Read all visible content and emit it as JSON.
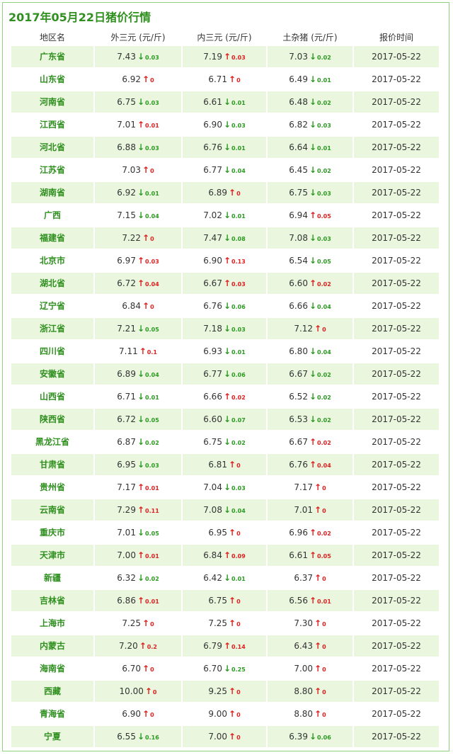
{
  "title": "2017年05月22日猪价行情",
  "headers": [
    "地区名",
    "外三元 (元/斤)",
    "内三元 (元/斤)",
    "土杂猪 (元/斤)",
    "报价时间"
  ],
  "colors": {
    "up": "#e02020",
    "down": "#2a9a20",
    "region": "#2f8f1f",
    "stripe": "#eaf7de"
  },
  "rows": [
    {
      "region": "广东省",
      "w": {
        "p": "7.43",
        "d": "down",
        "c": "0.03"
      },
      "n": {
        "p": "7.19",
        "d": "up",
        "c": "0.03"
      },
      "t": {
        "p": "7.03",
        "d": "down",
        "c": "0.02"
      },
      "date": "2017-05-22"
    },
    {
      "region": "山东省",
      "w": {
        "p": "6.92",
        "d": "up",
        "c": "0"
      },
      "n": {
        "p": "6.71",
        "d": "up",
        "c": "0"
      },
      "t": {
        "p": "6.49",
        "d": "down",
        "c": "0.01"
      },
      "date": "2017-05-22"
    },
    {
      "region": "河南省",
      "w": {
        "p": "6.75",
        "d": "down",
        "c": "0.03"
      },
      "n": {
        "p": "6.61",
        "d": "down",
        "c": "0.01"
      },
      "t": {
        "p": "6.48",
        "d": "down",
        "c": "0.02"
      },
      "date": "2017-05-22"
    },
    {
      "region": "江西省",
      "w": {
        "p": "7.01",
        "d": "up",
        "c": "0.01"
      },
      "n": {
        "p": "6.90",
        "d": "down",
        "c": "0.03"
      },
      "t": {
        "p": "6.82",
        "d": "down",
        "c": "0.03"
      },
      "date": "2017-05-22"
    },
    {
      "region": "河北省",
      "w": {
        "p": "6.88",
        "d": "down",
        "c": "0.03"
      },
      "n": {
        "p": "6.76",
        "d": "down",
        "c": "0.01"
      },
      "t": {
        "p": "6.64",
        "d": "down",
        "c": "0.01"
      },
      "date": "2017-05-22"
    },
    {
      "region": "江苏省",
      "w": {
        "p": "7.03",
        "d": "up",
        "c": "0"
      },
      "n": {
        "p": "6.77",
        "d": "down",
        "c": "0.04"
      },
      "t": {
        "p": "6.45",
        "d": "down",
        "c": "0.02"
      },
      "date": "2017-05-22"
    },
    {
      "region": "湖南省",
      "w": {
        "p": "6.92",
        "d": "down",
        "c": "0.01"
      },
      "n": {
        "p": "6.89",
        "d": "up",
        "c": "0"
      },
      "t": {
        "p": "6.75",
        "d": "down",
        "c": "0.03"
      },
      "date": "2017-05-22"
    },
    {
      "region": "广西",
      "w": {
        "p": "7.15",
        "d": "down",
        "c": "0.04"
      },
      "n": {
        "p": "7.02",
        "d": "down",
        "c": "0.01"
      },
      "t": {
        "p": "6.94",
        "d": "up",
        "c": "0.05"
      },
      "date": "2017-05-22"
    },
    {
      "region": "福建省",
      "w": {
        "p": "7.22",
        "d": "up",
        "c": "0"
      },
      "n": {
        "p": "7.47",
        "d": "down",
        "c": "0.08"
      },
      "t": {
        "p": "7.08",
        "d": "down",
        "c": "0.03"
      },
      "date": "2017-05-22"
    },
    {
      "region": "北京市",
      "w": {
        "p": "6.97",
        "d": "up",
        "c": "0.03"
      },
      "n": {
        "p": "6.90",
        "d": "up",
        "c": "0.13"
      },
      "t": {
        "p": "6.54",
        "d": "down",
        "c": "0.05"
      },
      "date": "2017-05-22"
    },
    {
      "region": "湖北省",
      "w": {
        "p": "6.72",
        "d": "up",
        "c": "0.04"
      },
      "n": {
        "p": "6.67",
        "d": "up",
        "c": "0.03"
      },
      "t": {
        "p": "6.60",
        "d": "up",
        "c": "0.02"
      },
      "date": "2017-05-22"
    },
    {
      "region": "辽宁省",
      "w": {
        "p": "6.84",
        "d": "up",
        "c": "0"
      },
      "n": {
        "p": "6.76",
        "d": "down",
        "c": "0.06"
      },
      "t": {
        "p": "6.66",
        "d": "down",
        "c": "0.04"
      },
      "date": "2017-05-22"
    },
    {
      "region": "浙江省",
      "w": {
        "p": "7.21",
        "d": "down",
        "c": "0.05"
      },
      "n": {
        "p": "7.18",
        "d": "down",
        "c": "0.03"
      },
      "t": {
        "p": "7.12",
        "d": "up",
        "c": "0"
      },
      "date": "2017-05-22"
    },
    {
      "region": "四川省",
      "w": {
        "p": "7.11",
        "d": "up",
        "c": "0.1"
      },
      "n": {
        "p": "6.93",
        "d": "down",
        "c": "0.01"
      },
      "t": {
        "p": "6.80",
        "d": "down",
        "c": "0.04"
      },
      "date": "2017-05-22"
    },
    {
      "region": "安徽省",
      "w": {
        "p": "6.89",
        "d": "down",
        "c": "0.04"
      },
      "n": {
        "p": "6.77",
        "d": "down",
        "c": "0.06"
      },
      "t": {
        "p": "6.67",
        "d": "down",
        "c": "0.02"
      },
      "date": "2017-05-22"
    },
    {
      "region": "山西省",
      "w": {
        "p": "6.71",
        "d": "down",
        "c": "0.01"
      },
      "n": {
        "p": "6.66",
        "d": "up",
        "c": "0.02"
      },
      "t": {
        "p": "6.52",
        "d": "down",
        "c": "0.02"
      },
      "date": "2017-05-22"
    },
    {
      "region": "陕西省",
      "w": {
        "p": "6.72",
        "d": "down",
        "c": "0.05"
      },
      "n": {
        "p": "6.60",
        "d": "down",
        "c": "0.07"
      },
      "t": {
        "p": "6.53",
        "d": "down",
        "c": "0.02"
      },
      "date": "2017-05-22"
    },
    {
      "region": "黑龙江省",
      "w": {
        "p": "6.87",
        "d": "down",
        "c": "0.02"
      },
      "n": {
        "p": "6.75",
        "d": "down",
        "c": "0.02"
      },
      "t": {
        "p": "6.67",
        "d": "up",
        "c": "0.02"
      },
      "date": "2017-05-22"
    },
    {
      "region": "甘肃省",
      "w": {
        "p": "6.95",
        "d": "down",
        "c": "0.03"
      },
      "n": {
        "p": "6.81",
        "d": "up",
        "c": "0"
      },
      "t": {
        "p": "6.76",
        "d": "up",
        "c": "0.04"
      },
      "date": "2017-05-22"
    },
    {
      "region": "贵州省",
      "w": {
        "p": "7.17",
        "d": "up",
        "c": "0.01"
      },
      "n": {
        "p": "7.04",
        "d": "down",
        "c": "0.03"
      },
      "t": {
        "p": "7.17",
        "d": "up",
        "c": "0"
      },
      "date": "2017-05-22"
    },
    {
      "region": "云南省",
      "w": {
        "p": "7.29",
        "d": "up",
        "c": "0.11"
      },
      "n": {
        "p": "7.08",
        "d": "down",
        "c": "0.04"
      },
      "t": {
        "p": "7.01",
        "d": "up",
        "c": "0"
      },
      "date": "2017-05-22"
    },
    {
      "region": "重庆市",
      "w": {
        "p": "7.01",
        "d": "down",
        "c": "0.05"
      },
      "n": {
        "p": "6.95",
        "d": "up",
        "c": "0"
      },
      "t": {
        "p": "6.96",
        "d": "up",
        "c": "0.02"
      },
      "date": "2017-05-22"
    },
    {
      "region": "天津市",
      "w": {
        "p": "7.00",
        "d": "up",
        "c": "0.01"
      },
      "n": {
        "p": "6.84",
        "d": "up",
        "c": "0.09"
      },
      "t": {
        "p": "6.61",
        "d": "up",
        "c": "0.05"
      },
      "date": "2017-05-22"
    },
    {
      "region": "新疆",
      "w": {
        "p": "6.32",
        "d": "down",
        "c": "0.02"
      },
      "n": {
        "p": "6.42",
        "d": "down",
        "c": "0.01"
      },
      "t": {
        "p": "6.37",
        "d": "up",
        "c": "0"
      },
      "date": "2017-05-22"
    },
    {
      "region": "吉林省",
      "w": {
        "p": "6.86",
        "d": "up",
        "c": "0.01"
      },
      "n": {
        "p": "6.75",
        "d": "up",
        "c": "0"
      },
      "t": {
        "p": "6.56",
        "d": "up",
        "c": "0.01"
      },
      "date": "2017-05-22"
    },
    {
      "region": "上海市",
      "w": {
        "p": "7.25",
        "d": "up",
        "c": "0"
      },
      "n": {
        "p": "7.25",
        "d": "up",
        "c": "0"
      },
      "t": {
        "p": "7.30",
        "d": "up",
        "c": "0"
      },
      "date": "2017-05-22"
    },
    {
      "region": "内蒙古",
      "w": {
        "p": "7.20",
        "d": "up",
        "c": "0.2"
      },
      "n": {
        "p": "6.79",
        "d": "up",
        "c": "0.14"
      },
      "t": {
        "p": "6.43",
        "d": "up",
        "c": "0"
      },
      "date": "2017-05-22"
    },
    {
      "region": "海南省",
      "w": {
        "p": "6.70",
        "d": "up",
        "c": "0"
      },
      "n": {
        "p": "6.70",
        "d": "down",
        "c": "0.25"
      },
      "t": {
        "p": "7.00",
        "d": "up",
        "c": "0"
      },
      "date": "2017-05-22"
    },
    {
      "region": "西藏",
      "w": {
        "p": "10.00",
        "d": "up",
        "c": "0"
      },
      "n": {
        "p": "9.25",
        "d": "up",
        "c": "0"
      },
      "t": {
        "p": "8.80",
        "d": "up",
        "c": "0"
      },
      "date": "2017-05-22"
    },
    {
      "region": "青海省",
      "w": {
        "p": "6.90",
        "d": "up",
        "c": "0"
      },
      "n": {
        "p": "9.00",
        "d": "up",
        "c": "0"
      },
      "t": {
        "p": "8.80",
        "d": "up",
        "c": "0"
      },
      "date": "2017-05-22"
    },
    {
      "region": "宁夏",
      "w": {
        "p": "6.55",
        "d": "down",
        "c": "0.16"
      },
      "n": {
        "p": "7.00",
        "d": "up",
        "c": "0"
      },
      "t": {
        "p": "6.39",
        "d": "down",
        "c": "0.06"
      },
      "date": "2017-05-22"
    }
  ]
}
